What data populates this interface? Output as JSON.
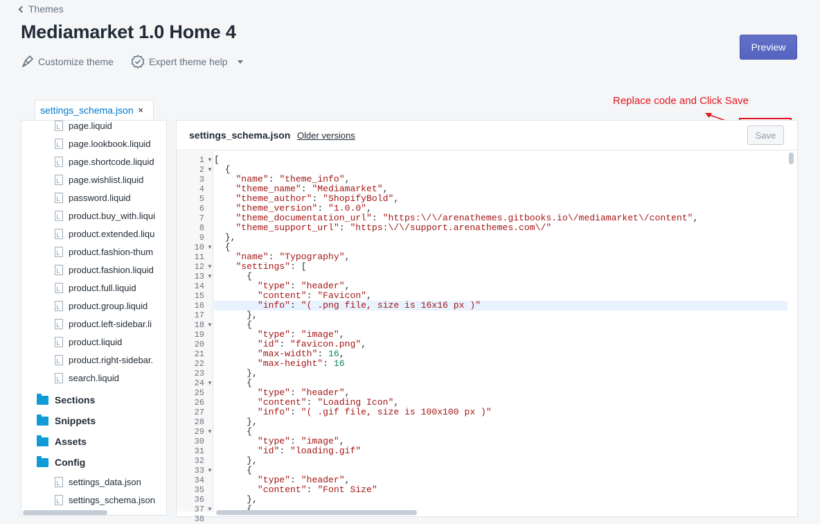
{
  "nav": {
    "back_label": "Themes"
  },
  "page": {
    "title": "Mediamarket 1.0 Home 4"
  },
  "actions": {
    "customize_label": "Customize theme",
    "help_label": "Expert theme help"
  },
  "preview_label": "Preview",
  "open_tab": {
    "name": "settings_schema.json",
    "close": "×"
  },
  "annotation": {
    "text": "Replace code and Click Save",
    "color": "#e3141d"
  },
  "sidebar": {
    "files_top": [
      "page.liquid",
      "page.lookbook.liquid",
      "page.shortcode.liquid",
      "page.wishlist.liquid",
      "password.liquid",
      "product.buy_with.liqui",
      "product.extended.liqu",
      "product.fashion-thum",
      "product.fashion.liquid",
      "product.full.liquid",
      "product.group.liquid",
      "product.left-sidebar.li",
      "product.liquid",
      "product.right-sidebar.",
      "search.liquid"
    ],
    "folders": [
      "Sections",
      "Snippets",
      "Assets",
      "Config"
    ],
    "config_files": [
      "settings_data.json",
      "settings_schema.json"
    ]
  },
  "editor": {
    "filename": "settings_schema.json",
    "older_versions": "Older versions",
    "save_label": "Save",
    "active_line": 16,
    "lines": [
      {
        "n": "1",
        "f": true,
        "t": "["
      },
      {
        "n": "2",
        "f": true,
        "t": "  {"
      },
      {
        "n": "3",
        "t": "    \"name\": \"theme_info\","
      },
      {
        "n": "4",
        "t": "    \"theme_name\": \"Mediamarket\","
      },
      {
        "n": "5",
        "t": "    \"theme_author\": \"ShopifyBold\","
      },
      {
        "n": "6",
        "t": "    \"theme_version\": \"1.0.0\","
      },
      {
        "n": "7",
        "t": "    \"theme_documentation_url\": \"https:\\/\\/arenathemes.gitbooks.io\\/mediamarket\\/content\","
      },
      {
        "n": "8",
        "t": "    \"theme_support_url\": \"https:\\/\\/support.arenathemes.com\\/\""
      },
      {
        "n": "9",
        "t": "  },"
      },
      {
        "n": "10",
        "f": true,
        "t": "  {"
      },
      {
        "n": "11",
        "t": "    \"name\": \"Typography\","
      },
      {
        "n": "12",
        "f": true,
        "t": "    \"settings\": ["
      },
      {
        "n": "13",
        "f": true,
        "t": "      {"
      },
      {
        "n": "14",
        "t": "        \"type\": \"header\","
      },
      {
        "n": "15",
        "t": "        \"content\": \"Favicon\","
      },
      {
        "n": "16",
        "t": "        \"info\": \"( .png file, size is 16x16 px )\""
      },
      {
        "n": "17",
        "t": "      },"
      },
      {
        "n": "18",
        "f": true,
        "t": "      {"
      },
      {
        "n": "19",
        "t": "        \"type\": \"image\","
      },
      {
        "n": "20",
        "t": "        \"id\": \"favicon.png\","
      },
      {
        "n": "21",
        "t": "        \"max-width\": 16,"
      },
      {
        "n": "22",
        "t": "        \"max-height\": 16"
      },
      {
        "n": "23",
        "t": "      },"
      },
      {
        "n": "24",
        "f": true,
        "t": "      {"
      },
      {
        "n": "25",
        "t": "        \"type\": \"header\","
      },
      {
        "n": "26",
        "t": "        \"content\": \"Loading Icon\","
      },
      {
        "n": "27",
        "t": "        \"info\": \"( .gif file, size is 100x100 px )\""
      },
      {
        "n": "28",
        "t": "      },"
      },
      {
        "n": "29",
        "f": true,
        "t": "      {"
      },
      {
        "n": "30",
        "t": "        \"type\": \"image\","
      },
      {
        "n": "31",
        "t": "        \"id\": \"loading.gif\""
      },
      {
        "n": "32",
        "t": "      },"
      },
      {
        "n": "33",
        "f": true,
        "t": "      {"
      },
      {
        "n": "34",
        "t": "        \"type\": \"header\","
      },
      {
        "n": "35",
        "t": "        \"content\": \"Font Size\""
      },
      {
        "n": "36",
        "t": "      },"
      },
      {
        "n": "37",
        "f": true,
        "t": "      {"
      },
      {
        "n": "38",
        "t": ""
      }
    ]
  }
}
